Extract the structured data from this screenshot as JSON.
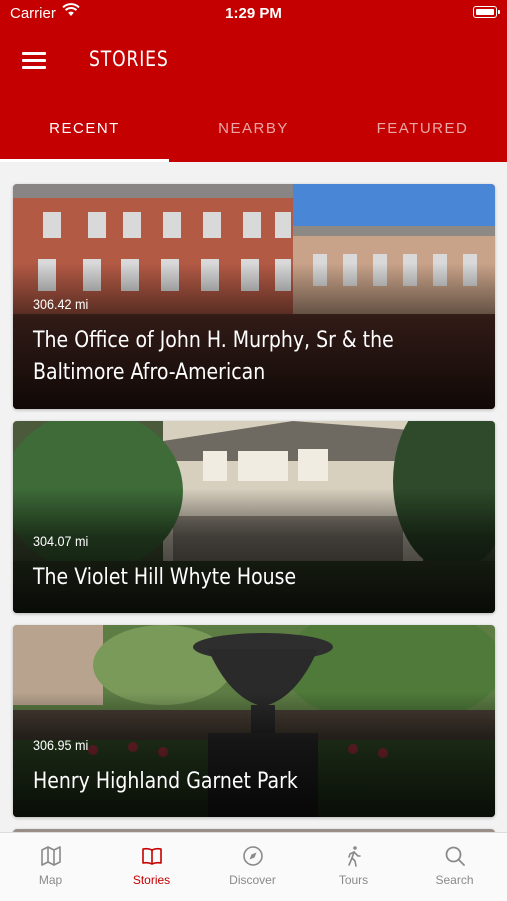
{
  "status_bar": {
    "carrier": "Carrier",
    "time": "1:29 PM"
  },
  "header": {
    "title": "STORIES"
  },
  "tabs": [
    {
      "label": "RECENT",
      "active": true
    },
    {
      "label": "NEARBY",
      "active": false
    },
    {
      "label": "FEATURED",
      "active": false
    }
  ],
  "stories": [
    {
      "distance": "306.42 mi",
      "title": "The Office of John H. Murphy, Sr & the Baltimore Afro-American"
    },
    {
      "distance": "304.07 mi",
      "title": "The Violet Hill Whyte House"
    },
    {
      "distance": "306.95 mi",
      "title": "Henry Highland Garnet Park"
    }
  ],
  "bottom_nav": [
    {
      "label": "Map",
      "icon": "map-icon",
      "active": false
    },
    {
      "label": "Stories",
      "icon": "book-icon",
      "active": true
    },
    {
      "label": "Discover",
      "icon": "compass-icon",
      "active": false
    },
    {
      "label": "Tours",
      "icon": "walking-icon",
      "active": false
    },
    {
      "label": "Search",
      "icon": "search-icon",
      "active": false
    }
  ],
  "colors": {
    "brand": "#c40000",
    "inactive": "#8a8a8a"
  }
}
